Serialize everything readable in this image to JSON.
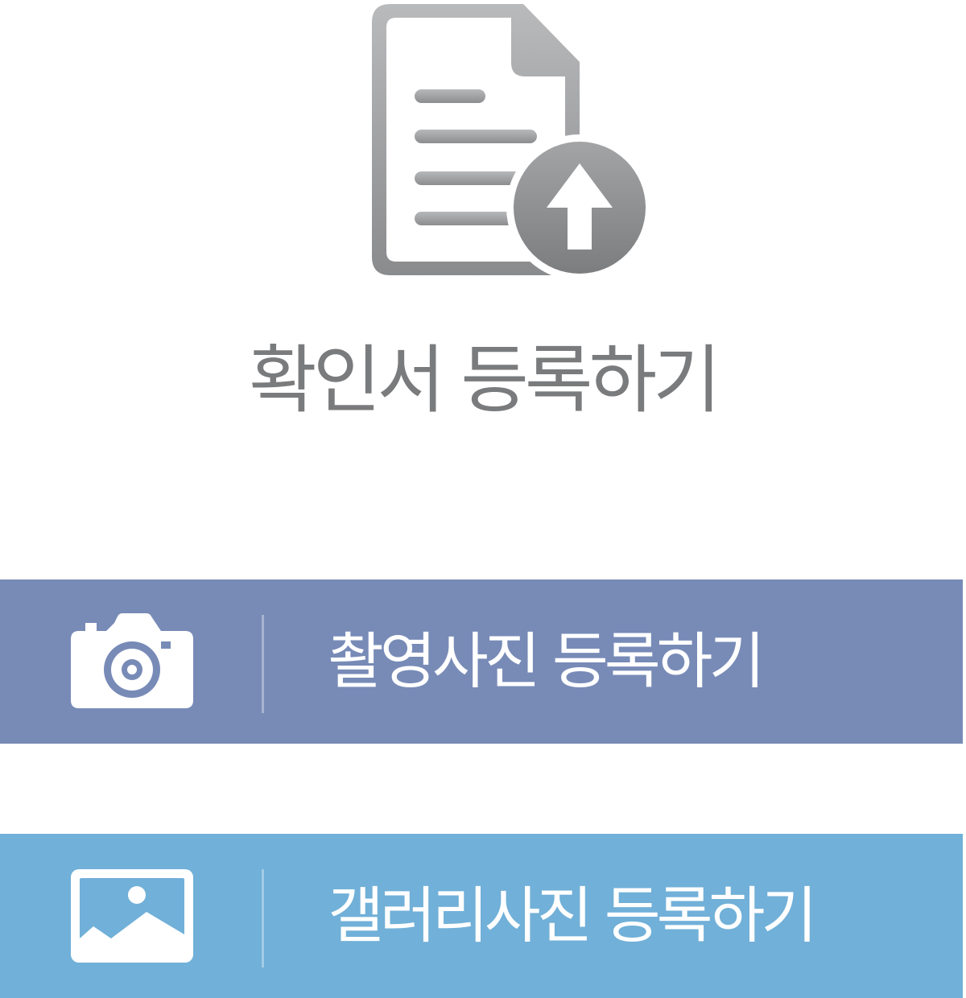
{
  "title": "확인서 등록하기",
  "icons": {
    "hero": "document-upload-icon",
    "camera": "camera-icon",
    "gallery": "image-icon"
  },
  "buttons": [
    {
      "label": "촬영사진 등록하기",
      "color": "#788bb7"
    },
    {
      "label": "갤러리사진 등록하기",
      "color": "#71b0d8"
    }
  ],
  "colors": {
    "title_text": "#7a7b7d",
    "icon_gray": "#8c8d8f",
    "button_text": "#ffffff"
  }
}
